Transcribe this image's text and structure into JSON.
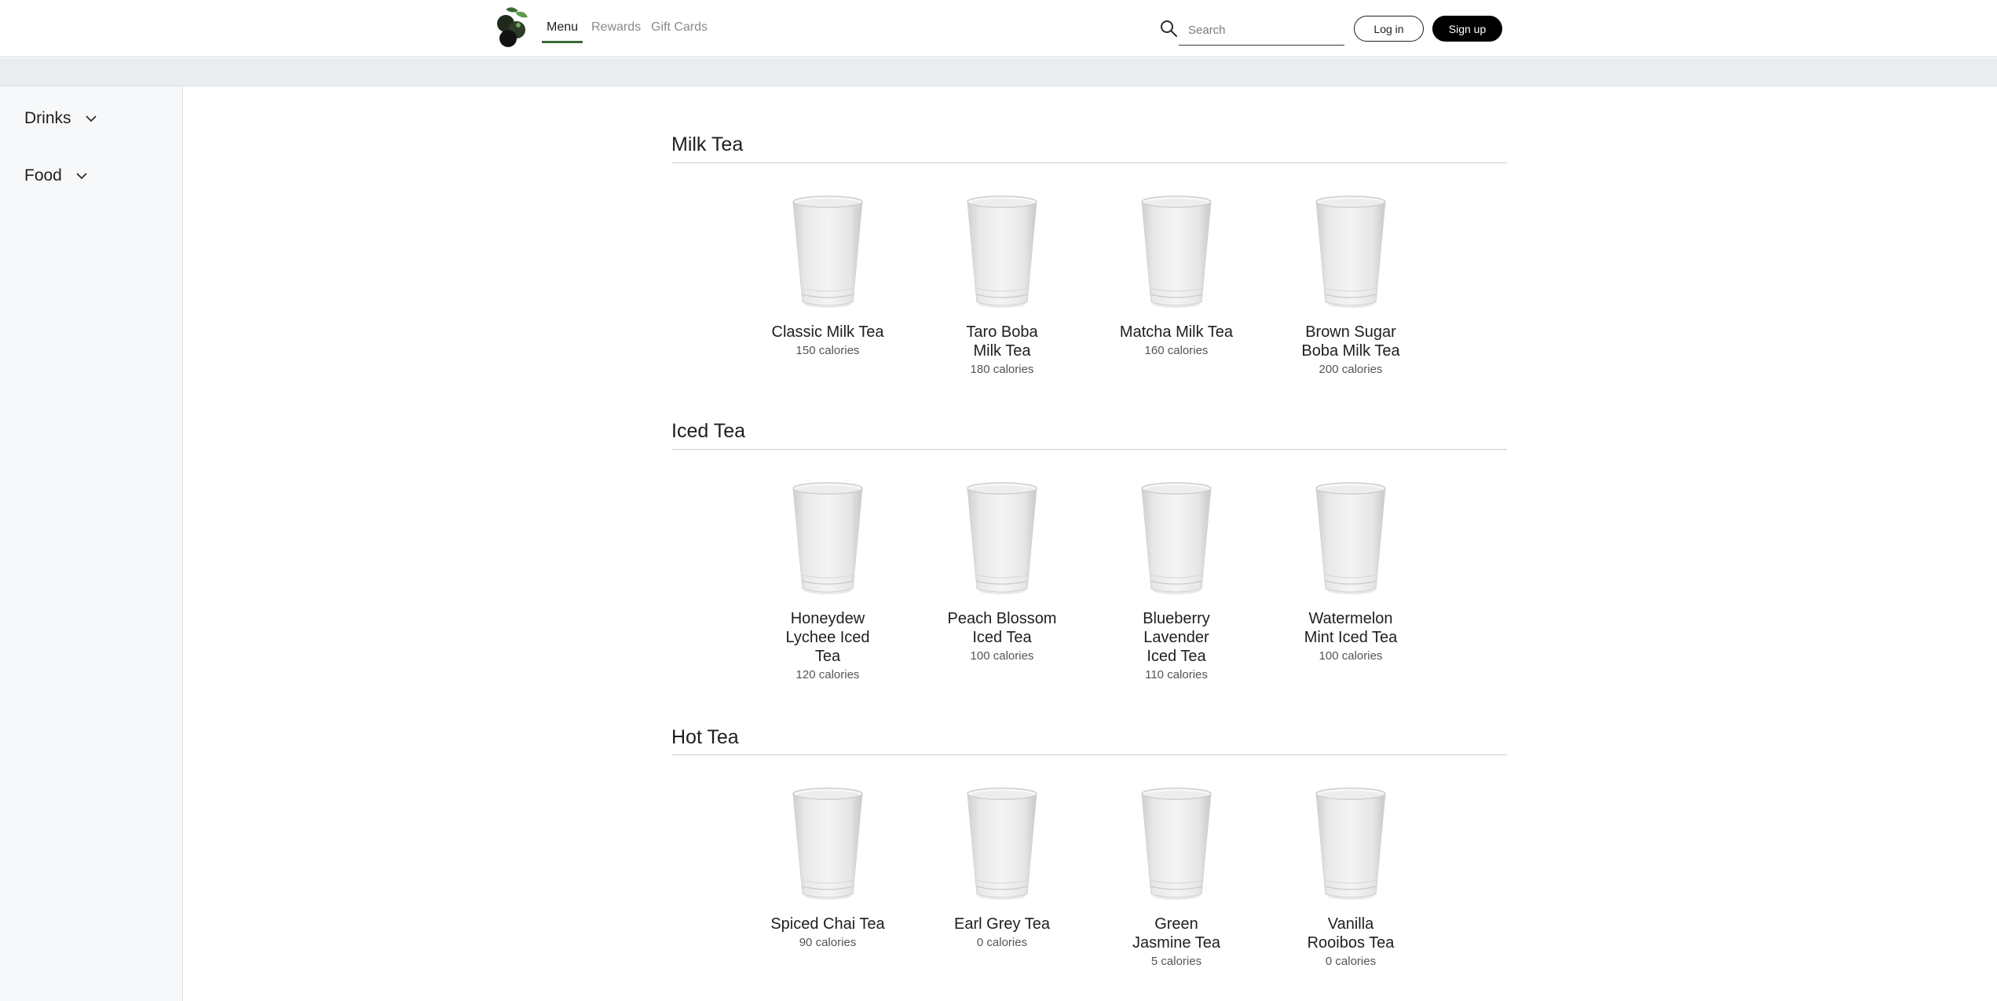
{
  "header": {
    "nav": [
      {
        "label": "Menu"
      },
      {
        "label": "Rewards"
      },
      {
        "label": "Gift Cards"
      }
    ],
    "search": {
      "placeholder": "Search"
    },
    "login_label": "Log in",
    "signup_label": "Sign up"
  },
  "sidebar": {
    "items": [
      {
        "label": "Drinks"
      },
      {
        "label": "Food"
      }
    ]
  },
  "colors": {
    "accent": "#3a6b35",
    "primary_button": "#000000"
  },
  "icons": [
    "logo-icon",
    "search-icon",
    "chevron-down-icon",
    "cup-icon"
  ],
  "sections": [
    {
      "title": "Milk Tea",
      "items": [
        {
          "name": "Classic Milk Tea",
          "calories": "150 calories"
        },
        {
          "name": "Taro Boba Milk Tea",
          "calories": "180 calories"
        },
        {
          "name": "Matcha Milk Tea",
          "calories": "160 calories"
        },
        {
          "name": "Brown Sugar Boba Milk Tea",
          "calories": "200 calories"
        }
      ]
    },
    {
      "title": "Iced Tea",
      "items": [
        {
          "name": "Honeydew Lychee Iced Tea",
          "calories": "120 calories"
        },
        {
          "name": "Peach Blossom Iced Tea",
          "calories": "100 calories"
        },
        {
          "name": "Blueberry Lavender Iced Tea",
          "calories": "110 calories"
        },
        {
          "name": "Watermelon Mint Iced Tea",
          "calories": "100 calories"
        }
      ]
    },
    {
      "title": "Hot Tea",
      "items": [
        {
          "name": "Spiced Chai Tea",
          "calories": "90 calories"
        },
        {
          "name": "Earl Grey Tea",
          "calories": "0 calories"
        },
        {
          "name": "Green Jasmine Tea",
          "calories": "5 calories"
        },
        {
          "name": "Vanilla Rooibos Tea",
          "calories": "0 calories"
        }
      ]
    }
  ]
}
